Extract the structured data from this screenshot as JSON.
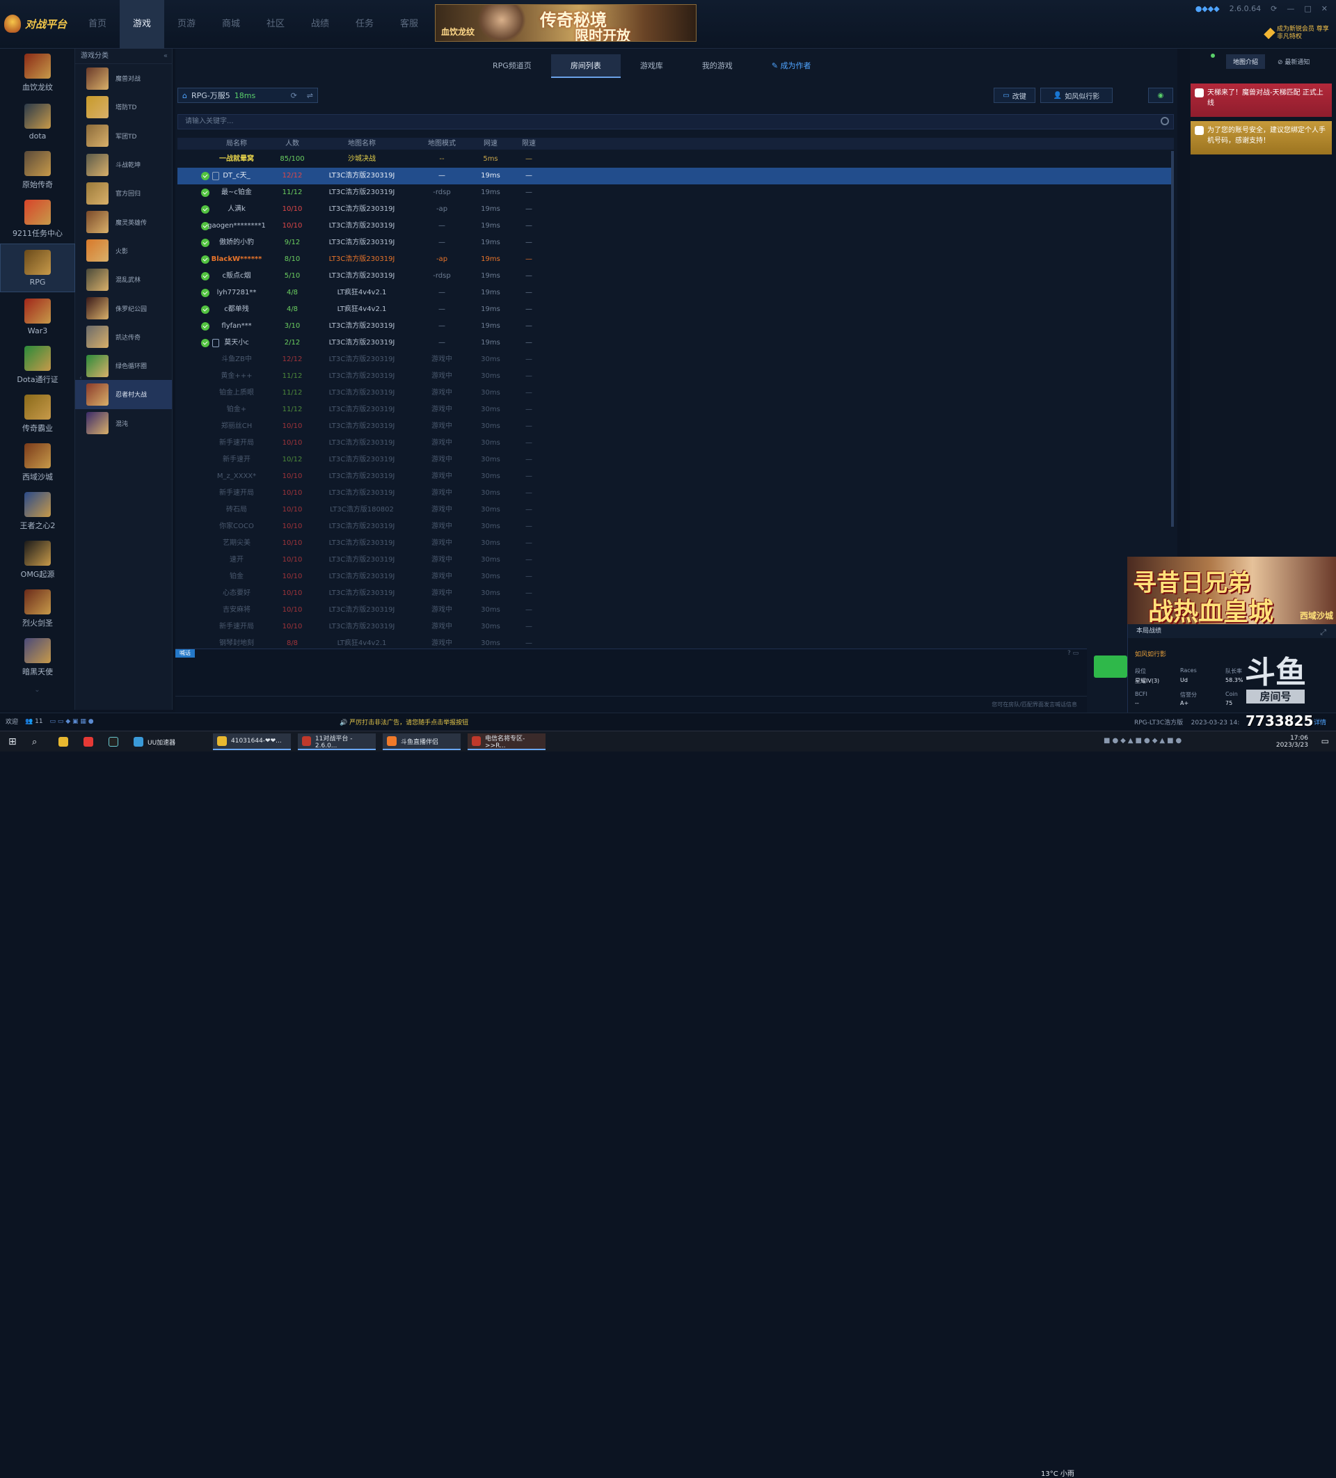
{
  "app": {
    "title": "对战平台",
    "version": "2.6.0.64",
    "vip": "成为新锐会员 尊享非凡特权"
  },
  "nav": [
    "首页",
    "游戏",
    "页游",
    "商城",
    "社区",
    "战绩",
    "任务",
    "客服"
  ],
  "banner": {
    "line1": "传奇秘境",
    "line2": "限时开放",
    "small": "血饮龙纹"
  },
  "left_games": [
    {
      "label": "血饮龙纹",
      "color": "#8a2a16"
    },
    {
      "label": "dota",
      "color": "#2b3a4a"
    },
    {
      "label": "原始传奇",
      "color": "#5a4a3a"
    },
    {
      "label": "9211任务中心",
      "color": "#d8442a"
    },
    {
      "label": "RPG",
      "color": "#6a4a1a"
    },
    {
      "label": "War3",
      "color": "#a0261a"
    },
    {
      "label": "Dota通行证",
      "color": "#2a8a3a"
    },
    {
      "label": "传奇霸业",
      "color": "#8a6a1a"
    },
    {
      "label": "西域沙城",
      "color": "#7a3a1a"
    },
    {
      "label": "王者之心2",
      "color": "#2a4a8a"
    },
    {
      "label": "OMG起源",
      "color": "#1a1a1a"
    },
    {
      "label": "烈火剑圣",
      "color": "#6a2a1a"
    },
    {
      "label": "暗黑天使",
      "color": "#4a4a7a"
    }
  ],
  "category": {
    "header": "游戏分类",
    "items": [
      {
        "label": "魔兽对战",
        "color": "#6a3a2a"
      },
      {
        "label": "塔防TD",
        "color": "#c79a2a"
      },
      {
        "label": "军团TD",
        "color": "#8a6a3a"
      },
      {
        "label": "斗战乾坤",
        "color": "#5a5a4a"
      },
      {
        "label": "官方回归",
        "color": "#9a7a3a"
      },
      {
        "label": "魔灵英雄传",
        "color": "#7a4a2a"
      },
      {
        "label": "火影",
        "color": "#d8782a"
      },
      {
        "label": "混乱武林",
        "color": "#4a4a3a"
      },
      {
        "label": "侏罗纪公园",
        "color": "#3a1a1a"
      },
      {
        "label": "凯达传奇",
        "color": "#6a6a6a"
      },
      {
        "label": "绿色循环圈",
        "color": "#2a8a3a"
      },
      {
        "label": "忍者村大战",
        "color": "#8a3a2a"
      },
      {
        "label": "混沌",
        "color": "#3a2a6a"
      }
    ]
  },
  "tabs": [
    "RPG频道页",
    "房间列表",
    "游戏库",
    "我的游戏",
    "成为作者"
  ],
  "server": {
    "name": "RPG-万服5",
    "ping": "18ms"
  },
  "buttons": {
    "change": "改键",
    "user": "如风似行影"
  },
  "search": {
    "placeholder": "请输入关键字..."
  },
  "table": {
    "headers": [
      "局名称",
      "人数",
      "地图名称",
      "地图模式",
      "网速",
      "限速"
    ],
    "rows": [
      {
        "name": "一战就晕窝",
        "count": "85/100",
        "map": "沙城决战",
        "mode": "--",
        "net": "5ms",
        "limit": "—",
        "state": "hdr"
      },
      {
        "name": "DT_c天_",
        "count": "12/12",
        "map": "LT3C浩方版230319J",
        "mode": "—",
        "net": "19ms",
        "limit": "—",
        "state": "sel",
        "check": true,
        "lock": true
      },
      {
        "name": "最~c铂金",
        "count": "11/12",
        "map": "LT3C浩方版230319J",
        "mode": "-rdsp",
        "net": "19ms",
        "limit": "—",
        "state": "open",
        "check": true
      },
      {
        "name": "人满k",
        "count": "10/10",
        "map": "LT3C浩方版230319J",
        "mode": "-ap",
        "net": "19ms",
        "limit": "—",
        "state": "open",
        "check": true
      },
      {
        "name": "gaogen********1",
        "count": "10/10",
        "map": "LT3C浩方版230319J",
        "mode": "—",
        "net": "19ms",
        "limit": "—",
        "state": "open",
        "check": true
      },
      {
        "name": "傲娇的小豹",
        "count": "9/12",
        "map": "LT3C浩方版230319J",
        "mode": "—",
        "net": "19ms",
        "limit": "—",
        "state": "open",
        "check": true
      },
      {
        "name": "BlackW******",
        "count": "8/10",
        "map": "LT3C浩方版230319J",
        "mode": "-ap",
        "net": "19ms",
        "limit": "—",
        "state": "orange",
        "check": true
      },
      {
        "name": "c贩点c烟",
        "count": "5/10",
        "map": "LT3C浩方版230319J",
        "mode": "-rdsp",
        "net": "19ms",
        "limit": "—",
        "state": "open",
        "check": true
      },
      {
        "name": "lyh77281**",
        "count": "4/8",
        "map": "LT疯狂4v4v2.1",
        "mode": "—",
        "net": "19ms",
        "limit": "—",
        "state": "open",
        "check": true
      },
      {
        "name": "c都单残",
        "count": "4/8",
        "map": "LT疯狂4v4v2.1",
        "mode": "—",
        "net": "19ms",
        "limit": "—",
        "state": "open",
        "check": true
      },
      {
        "name": "flyfan***",
        "count": "3/10",
        "map": "LT3C浩方版230319J",
        "mode": "—",
        "net": "19ms",
        "limit": "—",
        "state": "open",
        "check": true
      },
      {
        "name": "莫天小c",
        "count": "2/12",
        "map": "LT3C浩方版230319J",
        "mode": "—",
        "net": "19ms",
        "limit": "—",
        "state": "open",
        "check": true,
        "lock": true
      },
      {
        "name": "斗鱼ZB中",
        "count": "12/12",
        "map": "LT3C浩方版230319J",
        "mode": "游戏中",
        "net": "30ms",
        "limit": "—",
        "state": "dim"
      },
      {
        "name": "黄金+++",
        "count": "11/12",
        "map": "LT3C浩方版230319J",
        "mode": "游戏中",
        "net": "30ms",
        "limit": "—",
        "state": "dim"
      },
      {
        "name": "铂金上质眼",
        "count": "11/12",
        "map": "LT3C浩方版230319J",
        "mode": "游戏中",
        "net": "30ms",
        "limit": "—",
        "state": "dim"
      },
      {
        "name": "铂金+",
        "count": "11/12",
        "map": "LT3C浩方版230319J",
        "mode": "游戏中",
        "net": "30ms",
        "limit": "—",
        "state": "dim"
      },
      {
        "name": "郑丽丝CH",
        "count": "10/10",
        "map": "LT3C浩方版230319J",
        "mode": "游戏中",
        "net": "30ms",
        "limit": "—",
        "state": "dim"
      },
      {
        "name": "新手速开局",
        "count": "10/10",
        "map": "LT3C浩方版230319J",
        "mode": "游戏中",
        "net": "30ms",
        "limit": "—",
        "state": "dim"
      },
      {
        "name": "新手速开",
        "count": "10/12",
        "map": "LT3C浩方版230319J",
        "mode": "游戏中",
        "net": "30ms",
        "limit": "—",
        "state": "dim"
      },
      {
        "name": "M_z_XXXX*",
        "count": "10/10",
        "map": "LT3C浩方版230319J",
        "mode": "游戏中",
        "net": "30ms",
        "limit": "—",
        "state": "dim"
      },
      {
        "name": "新手速开局",
        "count": "10/10",
        "map": "LT3C浩方版230319J",
        "mode": "游戏中",
        "net": "30ms",
        "limit": "—",
        "state": "dim"
      },
      {
        "name": "砖石局",
        "count": "10/10",
        "map": "LT3C浩方版180802",
        "mode": "游戏中",
        "net": "30ms",
        "limit": "—",
        "state": "dim"
      },
      {
        "name": "你家COCO",
        "count": "10/10",
        "map": "LT3C浩方版230319J",
        "mode": "游戏中",
        "net": "30ms",
        "limit": "—",
        "state": "dim"
      },
      {
        "name": "艺期尖美",
        "count": "10/10",
        "map": "LT3C浩方版230319J",
        "mode": "游戏中",
        "net": "30ms",
        "limit": "—",
        "state": "dim"
      },
      {
        "name": "速开",
        "count": "10/10",
        "map": "LT3C浩方版230319J",
        "mode": "游戏中",
        "net": "30ms",
        "limit": "—",
        "state": "dim"
      },
      {
        "name": "铂金",
        "count": "10/10",
        "map": "LT3C浩方版230319J",
        "mode": "游戏中",
        "net": "30ms",
        "limit": "—",
        "state": "dim"
      },
      {
        "name": "心态要好",
        "count": "10/10",
        "map": "LT3C浩方版230319J",
        "mode": "游戏中",
        "net": "30ms",
        "limit": "—",
        "state": "dim"
      },
      {
        "name": "吉安麻将",
        "count": "10/10",
        "map": "LT3C浩方版230319J",
        "mode": "游戏中",
        "net": "30ms",
        "limit": "—",
        "state": "dim"
      },
      {
        "name": "新手速开局",
        "count": "10/10",
        "map": "LT3C浩方版230319J",
        "mode": "游戏中",
        "net": "30ms",
        "limit": "—",
        "state": "dim"
      },
      {
        "name": "钢琴封地刻",
        "count": "8/8",
        "map": "LT疯狂4v4v2.1",
        "mode": "游戏中",
        "net": "30ms",
        "limit": "—",
        "state": "dim"
      }
    ]
  },
  "chat": {
    "tag": "喊话",
    "footer": "您可在房队/匹配界面发言喊话信息"
  },
  "right": {
    "tabs": [
      "地图介绍",
      "最新通知"
    ],
    "notice1": "天梯来了！魔兽对战-天梯匹配 正式上线",
    "notice2": "为了您的账号安全，建议您绑定个人手机号码，感谢支持！"
  },
  "promo": {
    "line1": "寻昔日兄弟",
    "line2": "战热血皇城",
    "tag": "西域沙城"
  },
  "stats": {
    "header": "本局战绩",
    "name": "如风如行影",
    "k1": "段位",
    "v1": "星耀IV(3)",
    "k2": "Races",
    "v2": "Ud",
    "k3": "队长率",
    "v3": "58.3%",
    "k4": "BCFI",
    "v4": "--",
    "k5": "信誉分",
    "v5": "A+",
    "k6": "Coin",
    "v6": "75",
    "map": "RPG-LT3C浩方版",
    "date": "2023-03-23 14:",
    "detail": "详情"
  },
  "douyu": {
    "logo": "斗鱼",
    "room_label": "房间号",
    "room": "7733825"
  },
  "statusbar": {
    "user": "欢迎",
    "friends": "11",
    "warn": "严厉打击非法广告，请您随手点击举报按钮"
  },
  "taskbar": {
    "items": [
      "UU加速器",
      "41031644-❤❤...",
      "11对战平台 - 2.6.0...",
      "斗鱼直播伴侣",
      "电信名将专区->>R..."
    ],
    "weather": "13°C 小雨",
    "time": "17:06",
    "date": "2023/3/23"
  }
}
